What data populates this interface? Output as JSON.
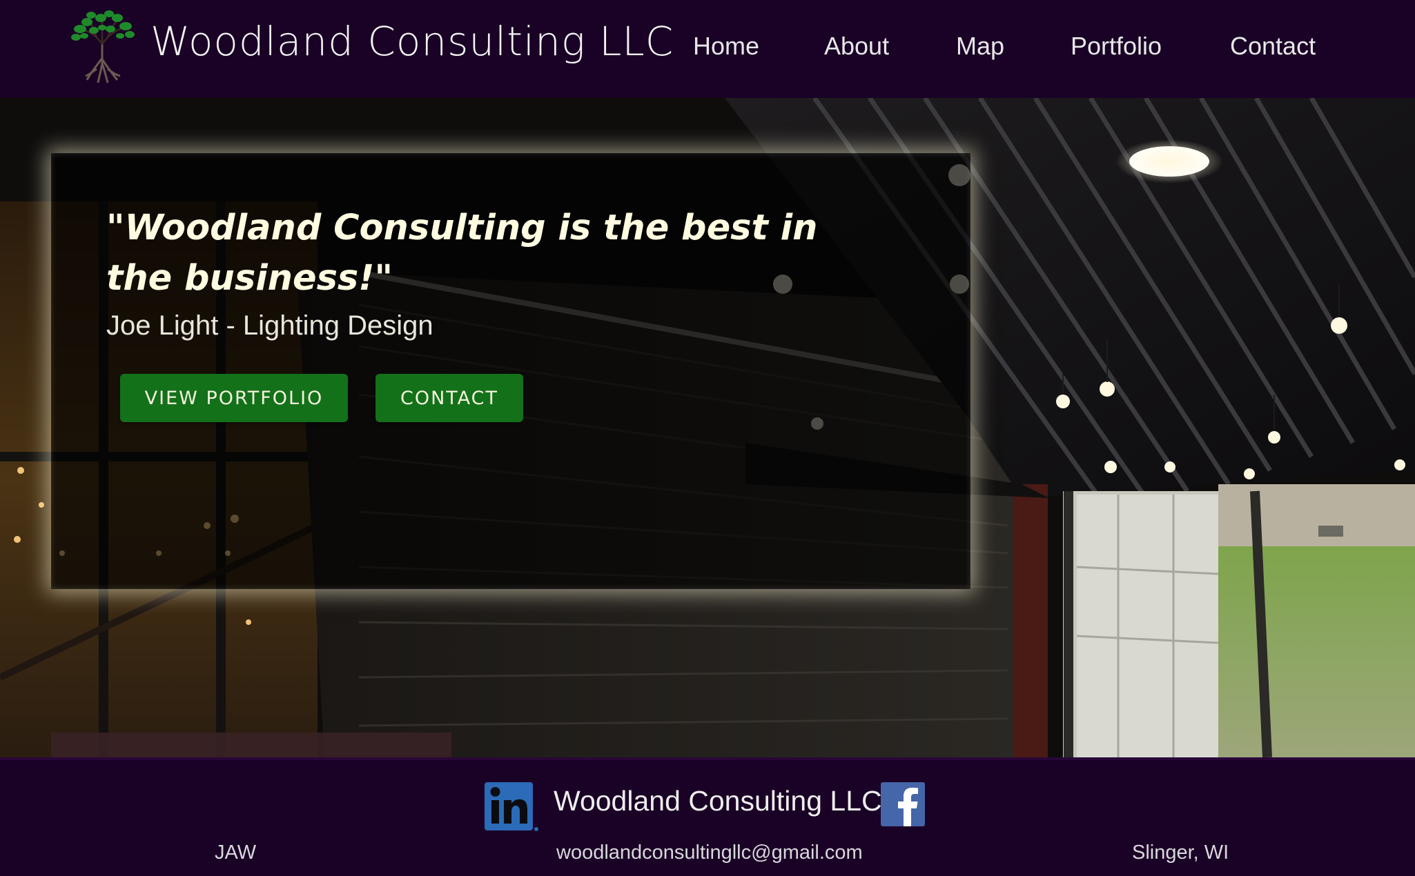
{
  "header": {
    "site_title": "Woodland Consulting LLC",
    "logo_icon": "tree-with-roots-icon",
    "nav": {
      "home": "Home",
      "about": "About",
      "map": "Map",
      "portfolio": "Portfolio",
      "contact": "Contact"
    }
  },
  "hero": {
    "quote": "\"Woodland Consulting is the best in the business!\"",
    "author": "Joe Light - Lighting Design",
    "buttons": {
      "view_portfolio": "VIEW PORTFOLIO",
      "contact": "CONTACT"
    }
  },
  "footer": {
    "linkedin_icon": "linkedin-icon",
    "facebook_icon": "facebook-icon",
    "title": "Woodland Consulting LLC",
    "initials": "JAW",
    "email": "woodlandconsultingllc@gmail.com",
    "location": "Slinger, WI"
  },
  "colors": {
    "header_bg": "#1a0126",
    "button_green": "#13711a",
    "quote_text": "#fffbe0"
  }
}
